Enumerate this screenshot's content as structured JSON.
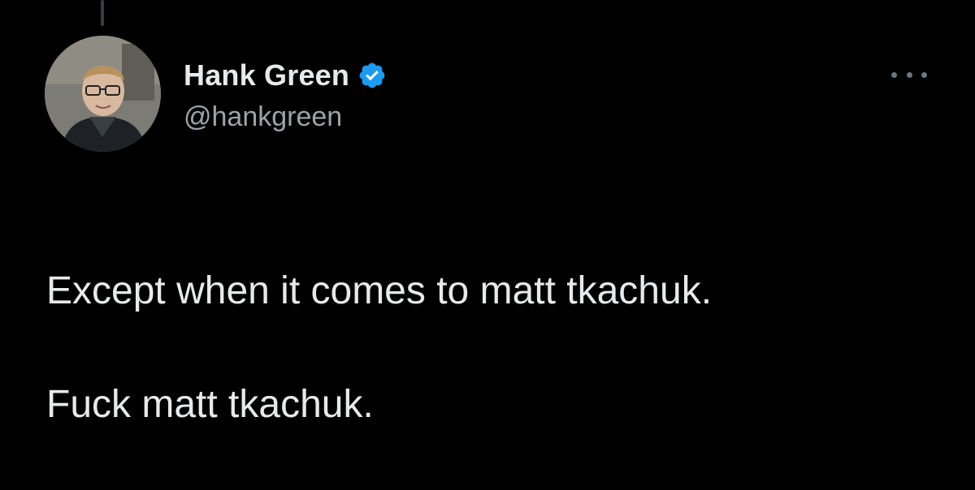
{
  "tweet": {
    "author": {
      "display_name": "Hank Green",
      "handle": "@hankgreen",
      "verified": true,
      "avatar_icon": "profile-photo"
    },
    "text_lines": [
      "Except when it comes to matt tkachuk.",
      "Fuck matt tkachuk."
    ],
    "more_menu_icon": "ellipsis-icon"
  },
  "colors": {
    "background": "#000000",
    "text_primary": "#e7e9ea",
    "text_secondary": "#9ea3a8",
    "verified_blue": "#1d9bf0"
  }
}
